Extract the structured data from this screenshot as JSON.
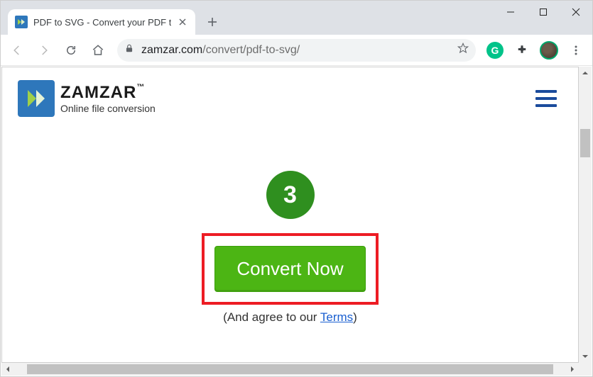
{
  "window": {
    "tab_title": "PDF to SVG - Convert your PDF t"
  },
  "browser": {
    "url_host": "zamzar.com",
    "url_path": "/convert/pdf-to-svg/",
    "ext_badge": "G"
  },
  "page": {
    "logo": {
      "brand": "ZAMZAR",
      "tm": "™",
      "tagline": "Online file conversion"
    },
    "step_number": "3",
    "convert_label": "Convert Now",
    "terms_prefix": "(And agree to our ",
    "terms_link": "Terms",
    "terms_suffix": ")"
  }
}
